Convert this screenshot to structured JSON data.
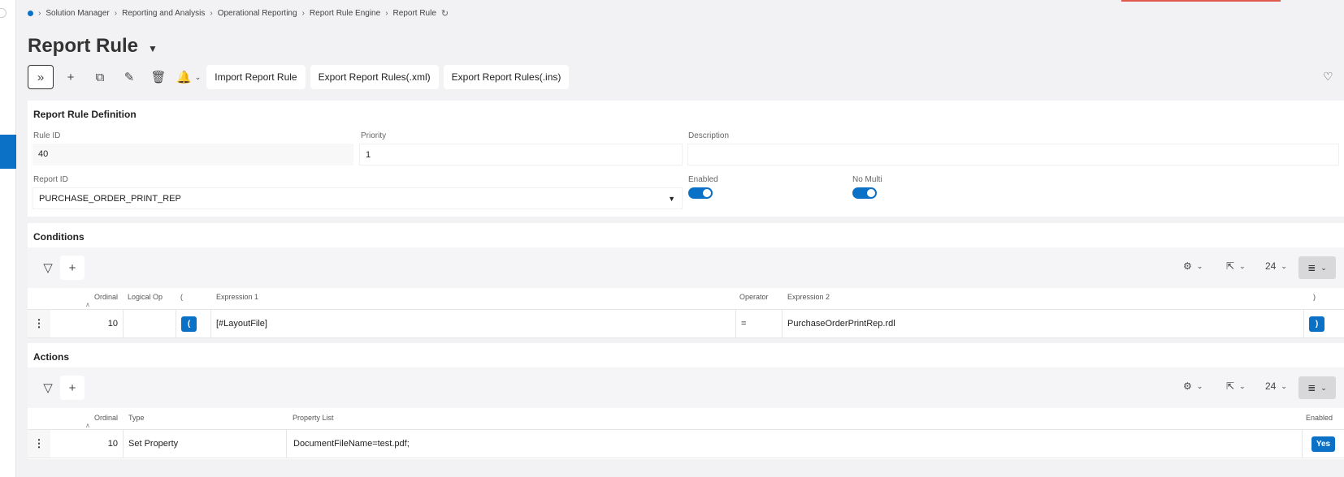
{
  "breadcrumb": {
    "items": [
      "Solution Manager",
      "Reporting and Analysis",
      "Operational Reporting",
      "Report Rule Engine",
      "Report Rule"
    ]
  },
  "page": {
    "title": "Report Rule"
  },
  "toolbar": {
    "import_label": "Import Report Rule",
    "export_xml_label": "Export Report Rules(.xml)",
    "export_ins_label": "Export Report Rules(.ins)"
  },
  "definition": {
    "title": "Report Rule Definition",
    "rule_id_label": "Rule ID",
    "rule_id_value": "40",
    "priority_label": "Priority",
    "priority_value": "1",
    "description_label": "Description",
    "description_value": "",
    "report_id_label": "Report ID",
    "report_id_value": "PURCHASE_ORDER_PRINT_REP",
    "enabled_label": "Enabled",
    "enabled_on": true,
    "no_multi_label": "No Multi",
    "no_multi_on": true
  },
  "conditions": {
    "title": "Conditions",
    "page_size": "24",
    "headers": {
      "ordinal": "Ordinal",
      "logical_op": "Logical Op",
      "open_paren": "(",
      "expression1": "Expression 1",
      "operator": "Operator",
      "expression2": "Expression 2",
      "close_paren": ")"
    },
    "rows": [
      {
        "ordinal": "10",
        "logical_op": "",
        "open_paren": "(",
        "expression1": "[#LayoutFile]",
        "operator": "=",
        "expression2": "PurchaseOrderPrintRep.rdl",
        "close_paren": ")"
      }
    ]
  },
  "actions": {
    "title": "Actions",
    "page_size": "24",
    "headers": {
      "ordinal": "Ordinal",
      "type": "Type",
      "property_list": "Property List",
      "enabled": "Enabled"
    },
    "rows": [
      {
        "ordinal": "10",
        "type": "Set Property",
        "property_list": "DocumentFileName=test.pdf;",
        "enabled": "Yes"
      }
    ]
  },
  "colors": {
    "accent": "#0b71c6",
    "top_accent": "#e0594d",
    "background": "#f2f1f3"
  },
  "icons": [
    "chevron-double-right-icon",
    "plus-icon",
    "duplicate-icon",
    "pencil-icon",
    "trash-icon",
    "bell-icon",
    "heart-icon",
    "filter-icon",
    "gear-icon",
    "export-icon",
    "list-view-icon",
    "refresh-icon",
    "kebab-icon"
  ]
}
